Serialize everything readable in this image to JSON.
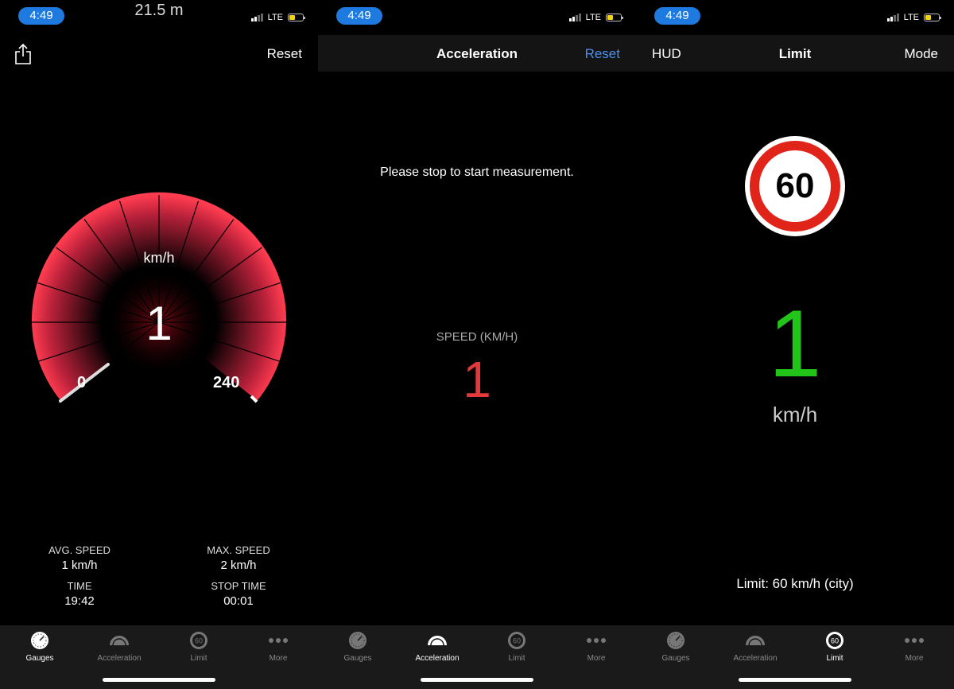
{
  "status": {
    "time": "4:49",
    "network": "LTE"
  },
  "gauges_screen": {
    "distance": "21.5 m",
    "reset": "Reset",
    "unit": "km/h",
    "speed": "1",
    "min": "0",
    "max": "240",
    "stats": {
      "avg_label": "AVG. SPEED",
      "avg_value": "1 km/h",
      "max_label": "MAX. SPEED",
      "max_value": "2 km/h",
      "time_label": "TIME",
      "time_value": "19:42",
      "stop_label": "STOP TIME",
      "stop_value": "00:01"
    }
  },
  "acceleration_screen": {
    "title": "Acceleration",
    "reset": "Reset",
    "message": "Please stop to start measurement.",
    "speed_label": "SPEED (KM/H)",
    "speed_value": "1"
  },
  "limit_screen": {
    "left": "HUD",
    "title": "Limit",
    "right": "Mode",
    "sign_value": "60",
    "speed": "1",
    "unit": "km/h",
    "limit_text": "Limit: 60 km/h (city)"
  },
  "tabs": [
    {
      "label": "Gauges",
      "icon": "speedometer-icon"
    },
    {
      "label": "Acceleration",
      "icon": "acceleration-icon"
    },
    {
      "label": "Limit",
      "icon": "speed-limit-icon"
    },
    {
      "label": "More",
      "icon": "more-icon"
    }
  ],
  "colors": {
    "accent": "#ff3c50",
    "limit_green": "#22c41a",
    "accel_red": "#e23a3a",
    "pill_blue": "#1f7ae0"
  }
}
